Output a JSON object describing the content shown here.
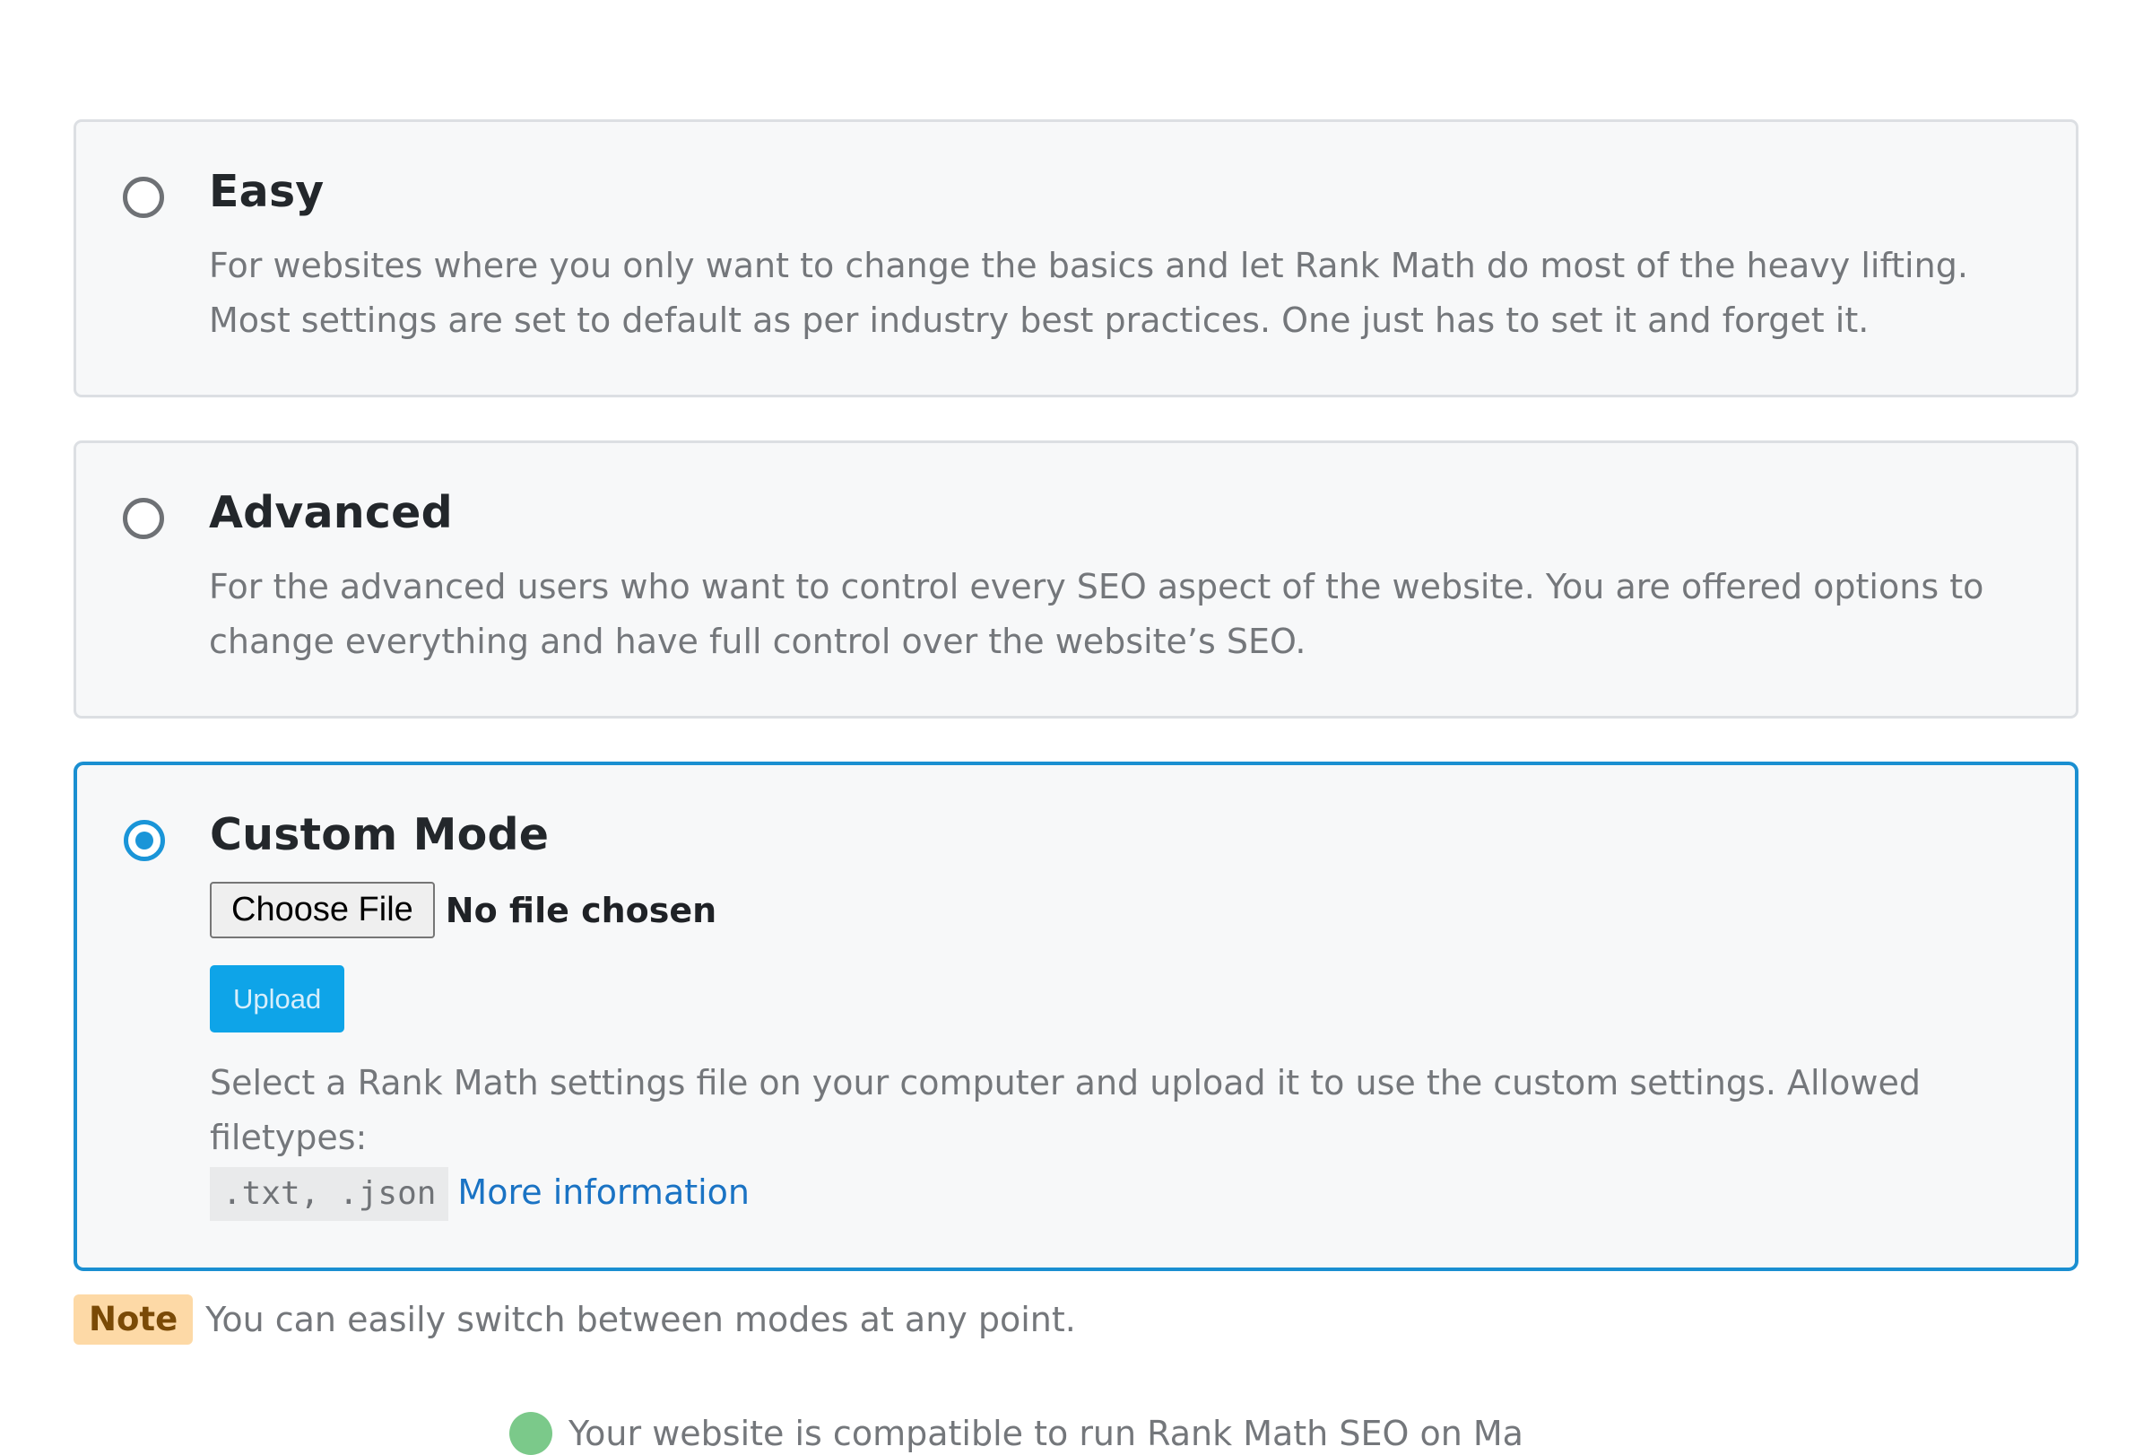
{
  "modes": [
    {
      "title": "Easy",
      "description": "For websites where you only want to change the basics and let Rank Math do most of the heavy lifting. Most settings are set to default as per industry best practices. One just has to set it and forget it.",
      "selected": false
    },
    {
      "title": "Advanced",
      "description": "For the advanced users who want to control every SEO aspect of the website. You are offered options to change everything and have full control over the website’s SEO.",
      "selected": false
    },
    {
      "title": "Custom Mode",
      "selected": true,
      "file_input": {
        "button_label": "Choose File",
        "status": "No file chosen"
      },
      "upload_label": "Upload",
      "help_text": "Select a Rank Math settings file on your computer and upload it to use the custom settings. Allowed filetypes:",
      "filetypes": ".txt, .json",
      "more_info_link": "More information"
    }
  ],
  "note": {
    "badge": "Note",
    "text": "You can easily switch between modes at any point."
  },
  "compatibility": {
    "text": "Your website is compatible to run Rank Math SEO on Ma"
  },
  "colors": {
    "accent": "#1a95d8",
    "upload_button": "#0ea4e8",
    "link": "#1a73c4",
    "note_badge_bg": "#fdd9a6",
    "note_badge_text": "#7a4a06",
    "success_icon": "#7bc98a"
  },
  "icons": {
    "radio_unchecked": "radio-unchecked-icon",
    "radio_checked": "radio-checked-icon",
    "compatibility": "check-circle-icon"
  }
}
